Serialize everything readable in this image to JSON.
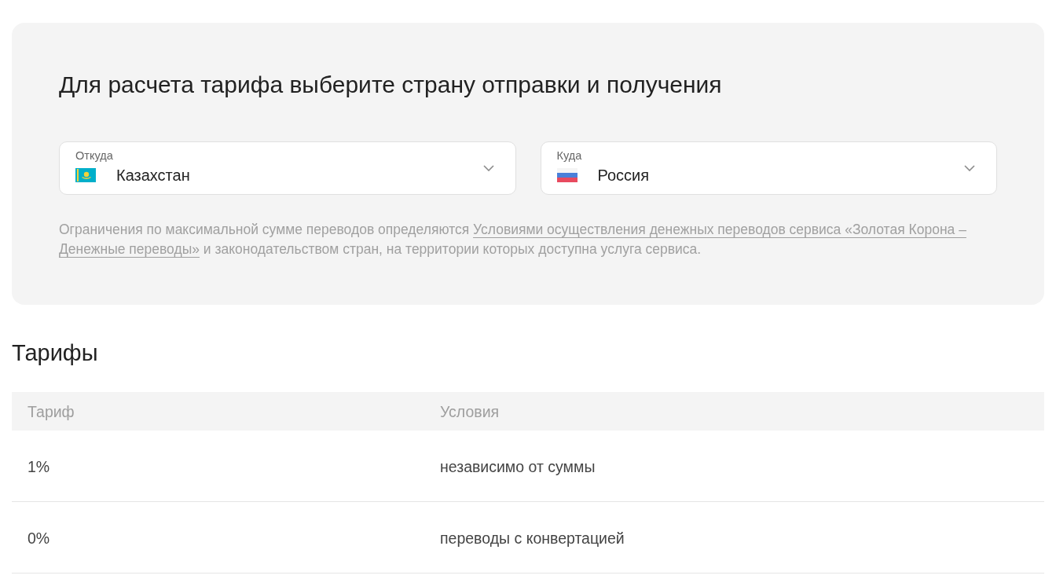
{
  "calculator": {
    "title": "Для расчета тарифа выберите страну отправки и получения",
    "selects": [
      {
        "label": "Откуда",
        "value": "Казахстан"
      },
      {
        "label": "Куда",
        "value": "Россия"
      }
    ],
    "note": {
      "text_before": "Ограничения по максимальной сумме переводов определяются",
      "link_lines": [
        "Условиями осуществления денежных переводов сервиса «Золотая Корона –",
        "Денежные переводы»"
      ],
      "text_after": "и законодательством стран, на территории которых доступна услуга сервиса."
    }
  },
  "tariffs": {
    "title": "Тарифы",
    "columns": [
      "Тариф",
      "Условия"
    ],
    "rows": [
      [
        "1%",
        "независимо от суммы"
      ],
      [
        "0%",
        "переводы с конвертацией"
      ]
    ]
  }
}
